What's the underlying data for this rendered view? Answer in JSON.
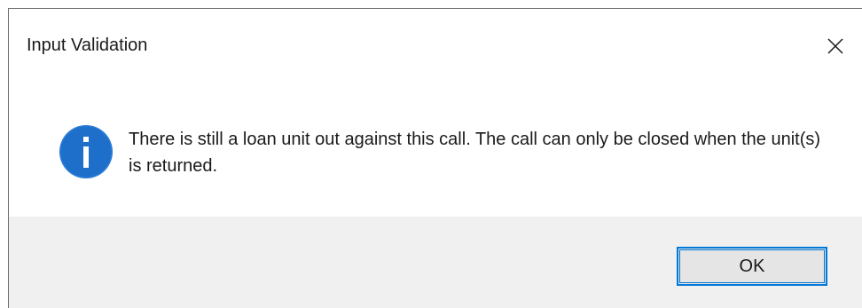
{
  "dialog": {
    "title": "Input Validation",
    "message": "There is still a loan unit out against this call. The call can only be closed when the unit(s) is returned.",
    "icon": "info-icon",
    "close_icon": "close-icon",
    "ok_label": "OK"
  },
  "colors": {
    "accent": "#0078d7",
    "footer_bg": "#f0f0f0",
    "button_bg": "#e5e5e5"
  }
}
